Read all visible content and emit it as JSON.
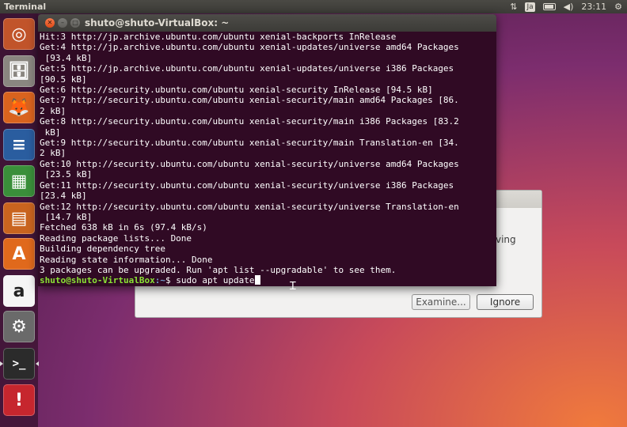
{
  "top_panel": {
    "app_title": "Terminal",
    "network_icon": "updown-arrows-icon",
    "keyboard_indicator": "Ja",
    "battery_icon": "battery-icon",
    "volume_icon": "speaker-icon",
    "clock": "23:11",
    "settings_icon": "gear-icon"
  },
  "launcher": {
    "items": [
      {
        "name": "dash",
        "icon": "ubuntu-logo-icon",
        "glyph": "◎",
        "color": "#c1542a"
      },
      {
        "name": "files",
        "icon": "file-cabinet-icon",
        "glyph": "🗄",
        "color": "#8a8680"
      },
      {
        "name": "firefox",
        "icon": "firefox-icon",
        "glyph": "🦊",
        "color": "#d9631e"
      },
      {
        "name": "writer",
        "icon": "writer-document-icon",
        "glyph": "≡",
        "color": "#2a5d9f"
      },
      {
        "name": "calc",
        "icon": "calc-spreadsheet-icon",
        "glyph": "▦",
        "color": "#3a8f3a"
      },
      {
        "name": "impress",
        "icon": "impress-presentation-icon",
        "glyph": "▤",
        "color": "#c9641f"
      },
      {
        "name": "software",
        "icon": "software-center-icon",
        "glyph": "A",
        "color": "#e0691c"
      },
      {
        "name": "amazon",
        "icon": "amazon-icon",
        "glyph": "a",
        "color": "#4a4a4a"
      },
      {
        "name": "system-settings",
        "icon": "settings-wrench-icon",
        "glyph": "⚙",
        "color": "#6a6a6a"
      },
      {
        "name": "terminal",
        "icon": "terminal-icon",
        "glyph": ">_",
        "color": "#2b2b2b"
      },
      {
        "name": "updates",
        "icon": "warning-exclamation-icon",
        "glyph": "!",
        "color": "#c6262e"
      }
    ]
  },
  "dialog": {
    "partial_text": "ving",
    "examine_label": "Examine...",
    "ignore_label": "Ignore"
  },
  "terminal": {
    "title": "shuto@shuto-VirtualBox: ~",
    "lines": [
      "Hit:3 http://jp.archive.ubuntu.com/ubuntu xenial-backports InRelease",
      "Get:4 http://jp.archive.ubuntu.com/ubuntu xenial-updates/universe amd64 Packages",
      " [93.4 kB]",
      "Get:5 http://jp.archive.ubuntu.com/ubuntu xenial-updates/universe i386 Packages",
      "[90.5 kB]",
      "Get:6 http://security.ubuntu.com/ubuntu xenial-security InRelease [94.5 kB]",
      "Get:7 http://security.ubuntu.com/ubuntu xenial-security/main amd64 Packages [86.",
      "2 kB]",
      "Get:8 http://security.ubuntu.com/ubuntu xenial-security/main i386 Packages [83.2",
      " kB]",
      "Get:9 http://security.ubuntu.com/ubuntu xenial-security/main Translation-en [34.",
      "2 kB]",
      "Get:10 http://security.ubuntu.com/ubuntu xenial-security/universe amd64 Packages",
      " [23.5 kB]",
      "Get:11 http://security.ubuntu.com/ubuntu xenial-security/universe i386 Packages",
      "[23.4 kB]",
      "Get:12 http://security.ubuntu.com/ubuntu xenial-security/universe Translation-en",
      " [14.7 kB]",
      "Fetched 638 kB in 6s (97.4 kB/s)",
      "Reading package lists... Done",
      "Building dependency tree",
      "Reading state information... Done",
      "3 packages can be upgraded. Run 'apt list --upgradable' to see them."
    ],
    "prompt_user": "shuto@shuto-VirtualBox",
    "prompt_path": ":~",
    "prompt_symbol": "$ ",
    "command": "sudo apt update"
  }
}
